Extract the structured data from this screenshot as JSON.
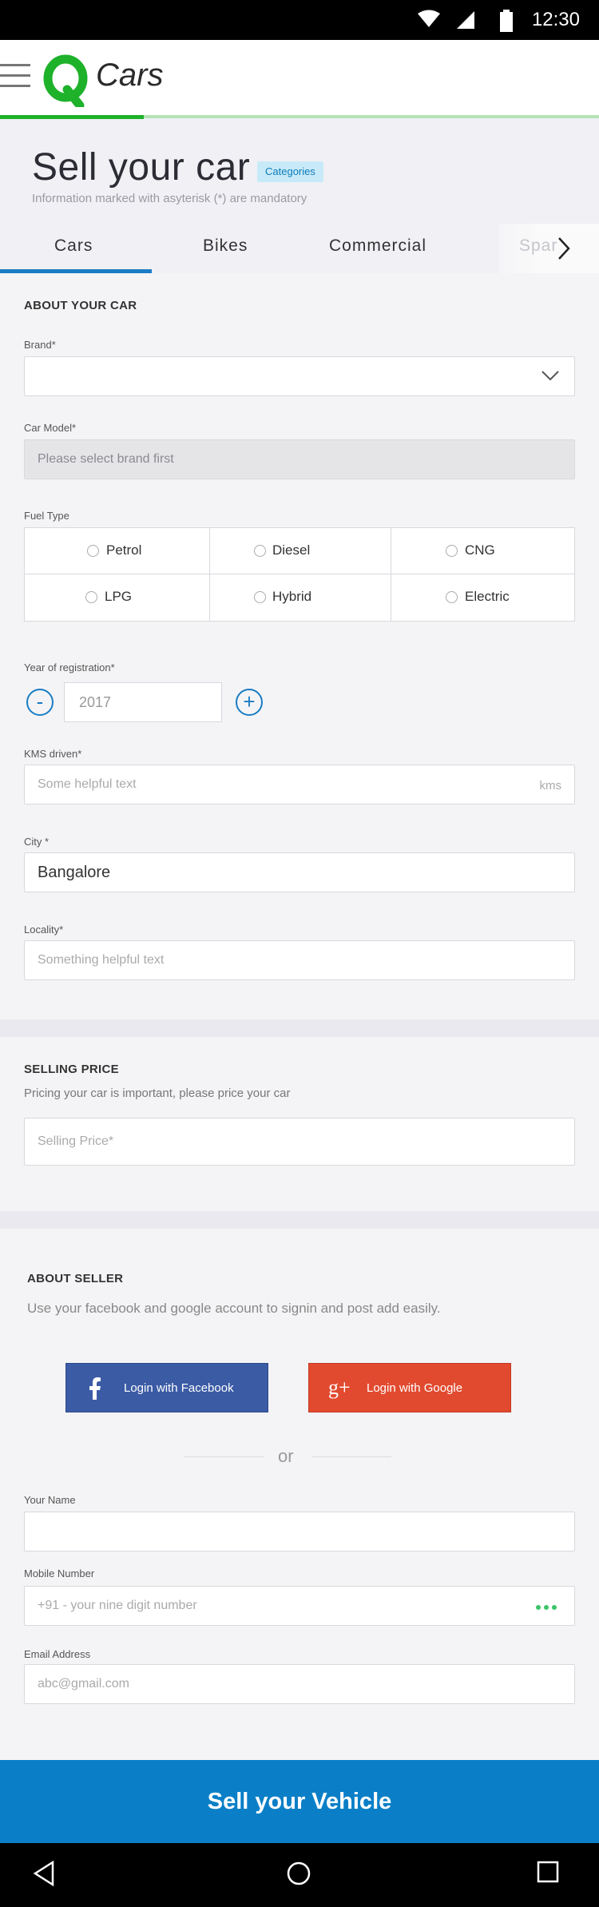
{
  "status_bar": {
    "time": "12:30"
  },
  "header": {
    "logo_letter": "Q",
    "app_name": "Cars",
    "progress": 0.24
  },
  "page": {
    "title": "Sell your car",
    "badge": "Categories",
    "subtitle": "Information marked with asyterisk (*) are mandatory"
  },
  "tabs": [
    {
      "label": "Cars",
      "active": true
    },
    {
      "label": "Bikes",
      "active": false
    },
    {
      "label": "Commercial",
      "active": false
    },
    {
      "label": "Spar",
      "active": false
    }
  ],
  "about_car": {
    "heading": "ABOUT YOUR CAR",
    "brand_label": "Brand*",
    "brand_value": "",
    "model_label": "Car Model*",
    "model_placeholder": "Please select brand first",
    "fuel_label": "Fuel Type",
    "fuel_options": [
      "Petrol",
      "Diesel",
      "CNG",
      "LPG",
      "Hybrid",
      "Electric"
    ],
    "year_label": "Year of registration*",
    "year_minus": "-",
    "year_value": "2017",
    "year_plus": "+",
    "kms_label": "KMS driven*",
    "kms_placeholder": "Some helpful text",
    "kms_unit": "kms",
    "city_label": "City *",
    "city_value": "Bangalore",
    "locality_label": "Locality*",
    "locality_placeholder": "Something helpful text"
  },
  "selling_price": {
    "heading": "SELLING PRICE",
    "description": "Pricing your car is important, please price your car",
    "placeholder": "Selling Price*"
  },
  "about_seller": {
    "heading": "ABOUT SELLER",
    "description": "Use your facebook and google account to signin and post add easily.",
    "facebook_label": "Login with Facebook",
    "google_label": "Login with Google",
    "or_text": "or",
    "name_label": "Your Name",
    "name_value": "",
    "mobile_label": "Mobile Number",
    "mobile_placeholder": "+91 - your nine digit number",
    "email_label": "Email Address",
    "email_placeholder": "abc@gmail.com"
  },
  "cta": {
    "label": "Sell your Vehicle"
  },
  "colors": {
    "accent": "#0a7fc7",
    "brand_green": "#1eb12a",
    "facebook": "#3b5ba5",
    "google": "#e14a2f"
  }
}
